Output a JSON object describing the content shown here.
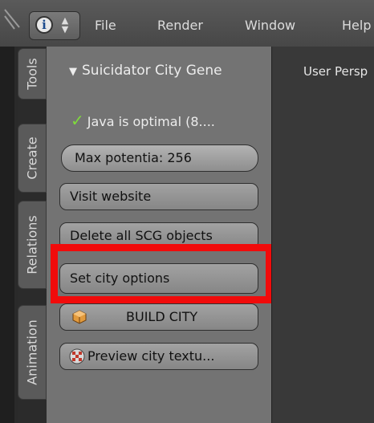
{
  "menu": {
    "items": [
      "File",
      "Render",
      "Window",
      "Help"
    ]
  },
  "tabs": [
    "Tools",
    "Create",
    "Relations",
    "Animation"
  ],
  "panel": {
    "header": "Suicidator City Generator",
    "header_shown": "Suicidator City Gene",
    "status": "Java is optimal (8....",
    "max_potentia": "Max potentia: 256",
    "visit_website": "Visit website",
    "delete_all": "Delete all SCG objects",
    "set_city_options": "Set city options",
    "build_city": "BUILD CITY",
    "preview_textures": "Preview city textu..."
  },
  "viewport": {
    "label": "User Persp"
  },
  "colors": {
    "highlight": "#f10b0b",
    "check": "#7fdb3c",
    "panel_bg": "#737373"
  },
  "icons": [
    "info-icon",
    "updown-icon",
    "check-icon",
    "cube-icon",
    "texture-icon",
    "triangle-down-icon"
  ]
}
